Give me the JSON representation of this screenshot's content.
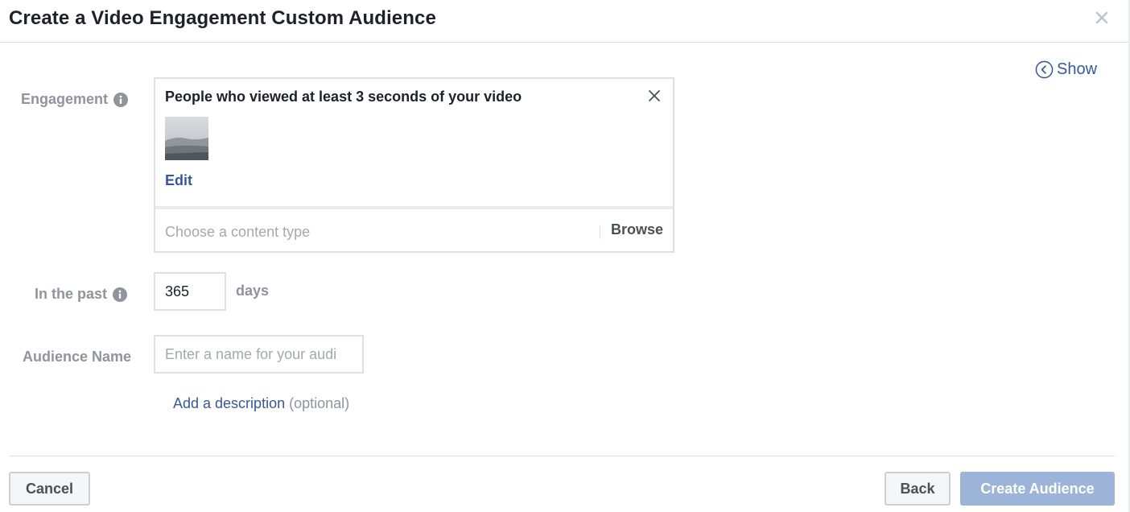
{
  "dialog": {
    "title": "Create a Video Engagement Custom Audience",
    "show_label": "Show"
  },
  "form": {
    "engagement_label": "Engagement",
    "engagement_headline": "People who viewed at least 3 seconds of your video",
    "edit_label": "Edit",
    "content_type_placeholder": "Choose a content type",
    "browse_label": "Browse",
    "past_label": "In the past",
    "days_value": "365",
    "days_unit": "days",
    "audience_name_label": "Audience Name",
    "audience_name_placeholder": "Enter a name for your audi",
    "add_description_label": "Add a description",
    "optional_label": "(optional)"
  },
  "footer": {
    "cancel_label": "Cancel",
    "back_label": "Back",
    "create_label": "Create Audience"
  },
  "colors": {
    "link_blue": "#365899",
    "label_gray": "#90949c",
    "disabled_primary": "#9cb4d8"
  }
}
